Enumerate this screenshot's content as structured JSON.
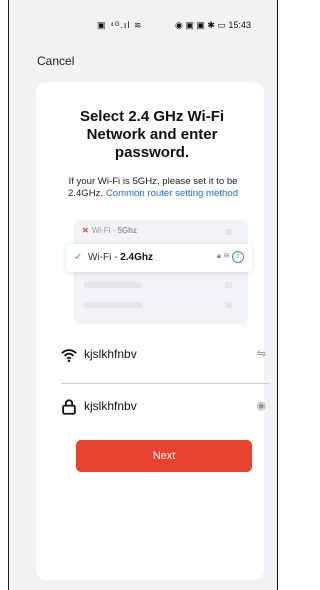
{
  "status_bar": {
    "left_icons": "▣ ⁴ᴳ.ıl ≋",
    "right_icons": "◉ ▣ ▣ ✱ ▭",
    "time": "15:43"
  },
  "header": {
    "cancel_label": "Cancel"
  },
  "card": {
    "title": "Select 2.4 GHz Wi-Fi Network and enter password.",
    "description": "If your Wi-Fi is 5GHz, please set it to be 2.4GHz.",
    "link": "Common router setting method"
  },
  "illustration": {
    "bad_network_prefix": "Wi-Fi - ",
    "bad_network_band": "5Ghz",
    "good_network_prefix": "Wi-Fi - ",
    "good_network_band": "2.4Ghz"
  },
  "form": {
    "wifi_name": "kjslkhfnbv",
    "password": "kjslkhfnbv",
    "next_label": "Next"
  },
  "icons": {
    "wifi": "wifi-icon",
    "lock": "lock-icon",
    "switch": "switch-network-icon",
    "eye": "eye-icon",
    "check": "check-icon",
    "cross": "cross-icon",
    "info": "info-icon"
  },
  "colors": {
    "accent": "#e8412d",
    "link": "#1f6fcf",
    "success": "#3bb54a",
    "error": "#e54c35"
  }
}
